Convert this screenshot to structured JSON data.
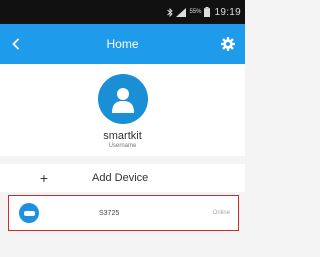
{
  "status_bar": {
    "time": "19:19",
    "battery": "55%"
  },
  "header": {
    "title": "Home"
  },
  "profile": {
    "name": "smartkit",
    "subtitle": "Username"
  },
  "actions": {
    "add_device_icon": "+",
    "add_device_label": "Add Device"
  },
  "devices": [
    {
      "name": "S3725",
      "status": "Online",
      "highlighted": true
    }
  ],
  "colors": {
    "accent": "#1e9bea",
    "highlight": "#d42a2a"
  }
}
